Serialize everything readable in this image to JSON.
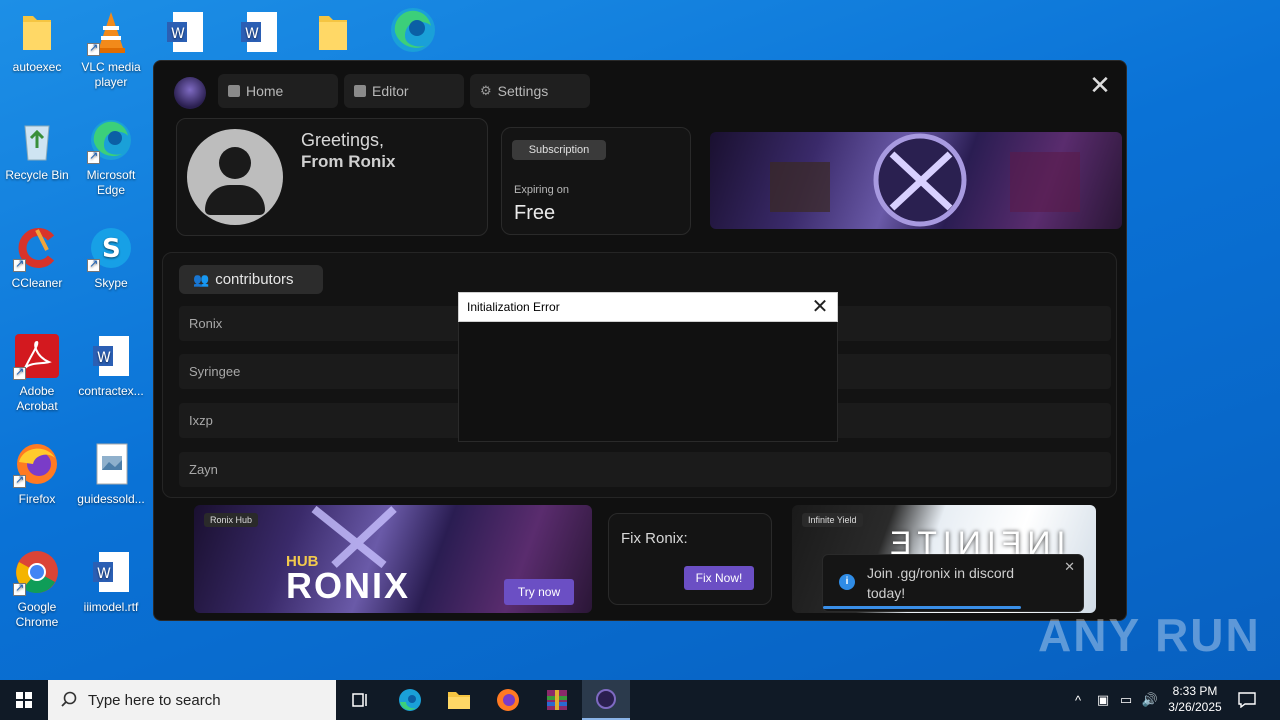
{
  "desktop": {
    "icons": [
      {
        "label": "autoexec"
      },
      {
        "label": "VLC media player"
      },
      {
        "label": "Recycle Bin"
      },
      {
        "label": "Microsoft Edge"
      },
      {
        "label": "CCleaner"
      },
      {
        "label": "Skype"
      },
      {
        "label": "Adobe Acrobat"
      },
      {
        "label": "contractex..."
      },
      {
        "label": "Firefox"
      },
      {
        "label": "guidessold..."
      },
      {
        "label": "Google Chrome"
      },
      {
        "label": "iiimodel.rtf"
      }
    ]
  },
  "app": {
    "tabs": [
      {
        "label": "Home",
        "icon": "archive-icon"
      },
      {
        "label": "Editor",
        "icon": "code-icon"
      },
      {
        "label": "Settings",
        "icon": "gear-icon"
      }
    ],
    "profile": {
      "greeting": "Greetings,",
      "from": "From Ronix"
    },
    "subscription": {
      "badge": "Subscription",
      "expiring_label": "Expiring on",
      "expiring_value": "Free"
    },
    "contributors": {
      "title": "contributors",
      "items": [
        "Ronix",
        "Syringee",
        "Ixzp",
        "Zayn"
      ]
    },
    "promo_ronix": {
      "tag": "Ronix Hub",
      "wordmark": "RONIX",
      "hub": "HUB",
      "button": "Try now"
    },
    "fix": {
      "title": "Fix Ronix:",
      "button": "Fix Now!"
    },
    "promo_infinite": {
      "tag": "Infinite Yield",
      "wordmark": "INFINITE"
    },
    "toast": {
      "message": "Join .gg/ronix in discord today!",
      "progress": 0.76
    }
  },
  "dialog": {
    "title": "Initialization Error"
  },
  "taskbar": {
    "search_placeholder": "Type here to search",
    "time": "8:33 PM",
    "date": "3/26/2025"
  },
  "watermark": "ANY RUN",
  "colors": {
    "accent_purple": "#6b4fc4",
    "toast_bar": "#3a8fe8",
    "desktop_blue": "#0a72d6"
  }
}
